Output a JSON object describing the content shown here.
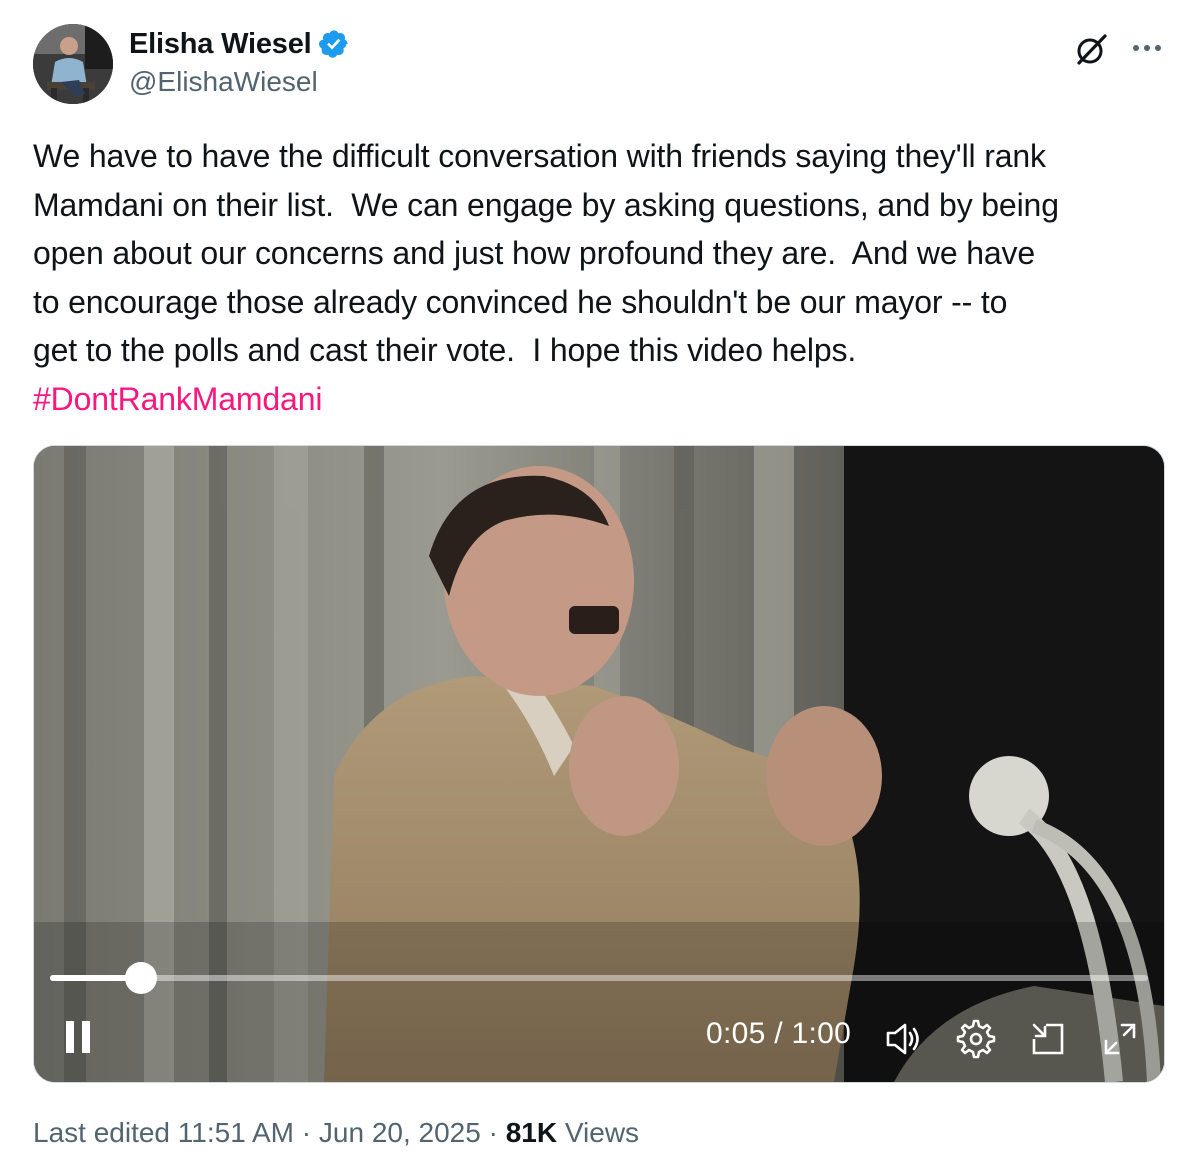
{
  "author": {
    "display_name": "Elisha Wiesel",
    "handle": "@ElishaWiesel",
    "verified": true,
    "verified_color": "#1d9bf0"
  },
  "tweet": {
    "text": "We have to have the difficult conversation with friends saying they'll rank\nMamdani on their list.  We can engage by asking questions, and by being\nopen about our concerns and just how profound they are.  And we have\nto encourage those already convinced he shouldn't be our mayor -- to\nget to the polls and cast their vote.  I hope this video helps.",
    "hashtag": "#DontRankMamdani",
    "hashtag_color": "#f91880"
  },
  "video": {
    "current_time": "0:05",
    "duration": "1:00",
    "time_display": "0:05 / 1:00",
    "progress_fraction": 0.083
  },
  "icons": {
    "grok": "grok-icon",
    "more": "more-icon",
    "pause": "pause-icon",
    "volume": "volume-icon",
    "settings": "gear-icon",
    "pip": "picture-in-picture-icon",
    "fullscreen": "fullscreen-icon"
  },
  "footer": {
    "edited_label": "Last edited 11:51 AM",
    "separator": " · ",
    "date": "Jun 20, 2025",
    "views_count": "81K",
    "views_label": "Views"
  }
}
